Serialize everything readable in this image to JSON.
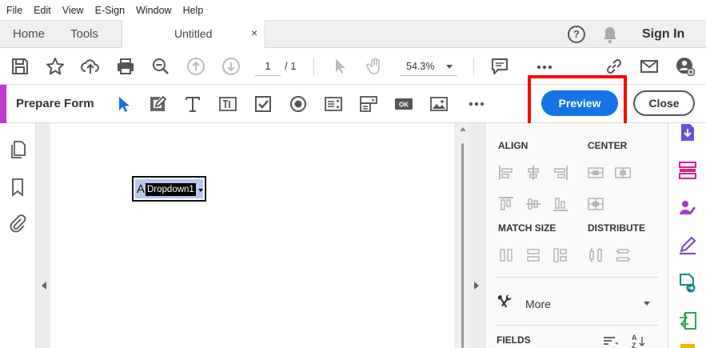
{
  "menu": [
    "File",
    "Edit",
    "View",
    "E-Sign",
    "Window",
    "Help"
  ],
  "tabs": {
    "home": "Home",
    "tools": "Tools",
    "document": "Untitled",
    "close": "×"
  },
  "header": {
    "help": "?",
    "sign_in": "Sign In"
  },
  "toolbar": {
    "page_current": "1",
    "page_total": "/ 1",
    "zoom": "54.3%"
  },
  "form_bar": {
    "label": "Prepare Form",
    "preview": "Preview",
    "close": "Close"
  },
  "document": {
    "field_letter": "A",
    "field_name": "Dropdown1"
  },
  "right_panel": {
    "align": "ALIGN",
    "center": "CENTER",
    "match_size": "MATCH SIZE",
    "distribute": "DISTRIBUTE",
    "more": "More",
    "fields": "FIELDS"
  },
  "colors": {
    "accent_blue": "#1473e6",
    "form_accent": "#c238ce",
    "highlight": "#ff0000"
  }
}
